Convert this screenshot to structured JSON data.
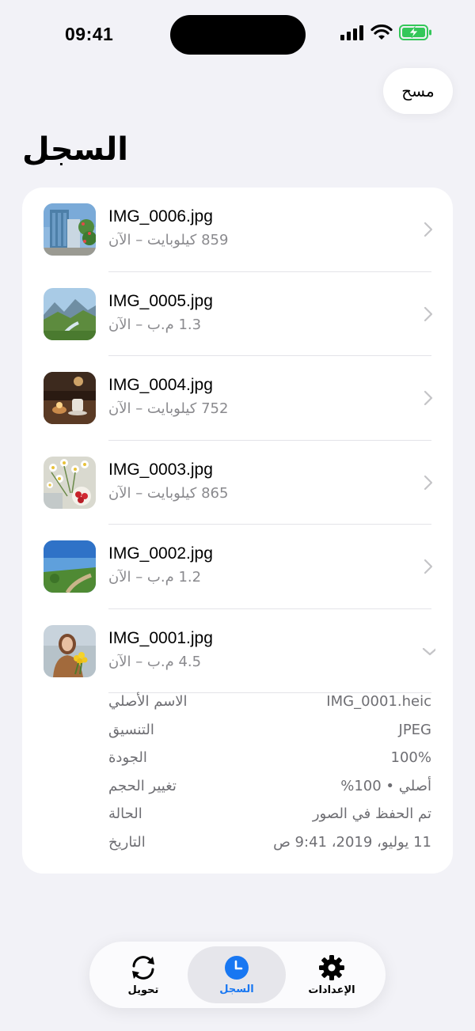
{
  "status": {
    "time": "09:41"
  },
  "header": {
    "clear_label": "مسح",
    "title": "السجل"
  },
  "history": [
    {
      "name": "IMG_0006.jpg",
      "meta": "859 كيلوبايت – الآن",
      "thumb": "building-photo"
    },
    {
      "name": "IMG_0005.jpg",
      "meta": "1.3 م.ب – الآن",
      "thumb": "mountain-valley-photo"
    },
    {
      "name": "IMG_0004.jpg",
      "meta": "752 كيلوبايت – الآن",
      "thumb": "candle-table-photo"
    },
    {
      "name": "IMG_0003.jpg",
      "meta": "865 كيلوبايت – الآن",
      "thumb": "flowers-strawberries-photo"
    },
    {
      "name": "IMG_0002.jpg",
      "meta": "1.2 م.ب – الآن",
      "thumb": "coast-path-photo"
    },
    {
      "name": "IMG_0001.jpg",
      "meta": "4.5 م.ب – الآن",
      "thumb": "woman-flowers-photo",
      "expanded": true
    }
  ],
  "details": [
    {
      "label": "الاسم الأصلي",
      "value": "IMG_0001.heic"
    },
    {
      "label": "التنسيق",
      "value": "JPEG"
    },
    {
      "label": "الجودة",
      "value": "100%"
    },
    {
      "label": "تغيير الحجم",
      "value": "أصلي • 100%"
    },
    {
      "label": "الحالة",
      "value": "تم الحفظ في الصور"
    },
    {
      "label": "التاريخ",
      "value": "11 يوليو، 2019، 9:41 ص"
    }
  ],
  "tabs": {
    "convert": {
      "label": "تحويل",
      "icon": "convert-icon"
    },
    "history": {
      "label": "السجل",
      "icon": "clock-icon",
      "active": true
    },
    "settings": {
      "label": "الإعدادات",
      "icon": "gear-icon"
    }
  },
  "colors": {
    "accent": "#1877f2",
    "background": "#f2f2f7",
    "battery": "#34c759"
  }
}
